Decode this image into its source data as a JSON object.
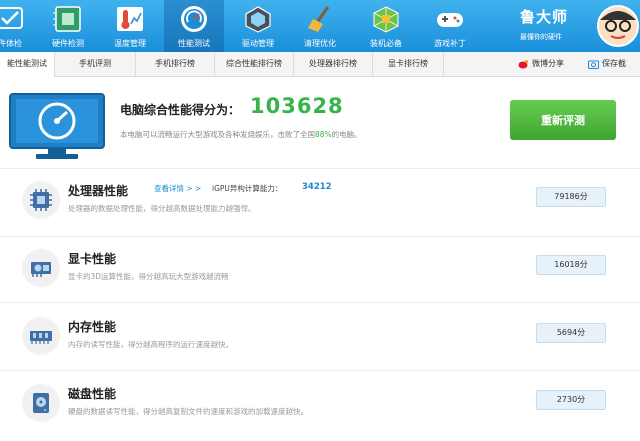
{
  "toolbar": {
    "items": [
      {
        "label": "件体检",
        "icon": "checkup-icon"
      },
      {
        "label": "硬件检测",
        "icon": "hardware-icon"
      },
      {
        "label": "温度管理",
        "icon": "thermometer-icon"
      },
      {
        "label": "性能测试",
        "icon": "speedometer-icon"
      },
      {
        "label": "驱动管理",
        "icon": "driver-icon"
      },
      {
        "label": "清理优化",
        "icon": "broom-icon"
      },
      {
        "label": "装机必备",
        "icon": "box-icon"
      },
      {
        "label": "游戏补丁",
        "icon": "gamepad-icon"
      }
    ],
    "brand_name": "鲁大师",
    "brand_slogan": "最懂你的硬件"
  },
  "tabs": [
    "能性能测试",
    "手机评测",
    "手机排行榜",
    "综合性能排行榜",
    "处理器排行榜",
    "显卡排行榜"
  ],
  "share": {
    "weibo": "微博分享",
    "save": "保存截"
  },
  "score": {
    "title": "电脑综合性能得分为：",
    "value": "103628",
    "desc_prefix": "本电脑可以流畅运行大型游戏及各种发烧娱乐，击败了全国",
    "desc_pct": "88%",
    "desc_suffix": "的电脑。",
    "retest_label": "重新评测"
  },
  "sections": [
    {
      "title": "处理器性能",
      "desc": "处理器的数据处理性能，得分越高数据处理能力越强悍。",
      "score": "79186分",
      "detail_link": "查看详情 > >",
      "extra_label": "iGPU异构计算能力：",
      "extra_value": "34212",
      "icon": "cpu-icon"
    },
    {
      "title": "显卡性能",
      "desc": "显卡的3D运算性能，得分越高玩大型游戏越流畅",
      "score": "16018分",
      "icon": "gpu-icon"
    },
    {
      "title": "内存性能",
      "desc": "内存的读写性能，得分越高程序的运行速度越快。",
      "score": "5694分",
      "icon": "memory-icon"
    },
    {
      "title": "磁盘性能",
      "desc": "硬盘的数据读写性能，得分越高复制文件的速度和游戏的加载速度越快。",
      "score": "2730分",
      "icon": "disk-icon"
    }
  ]
}
